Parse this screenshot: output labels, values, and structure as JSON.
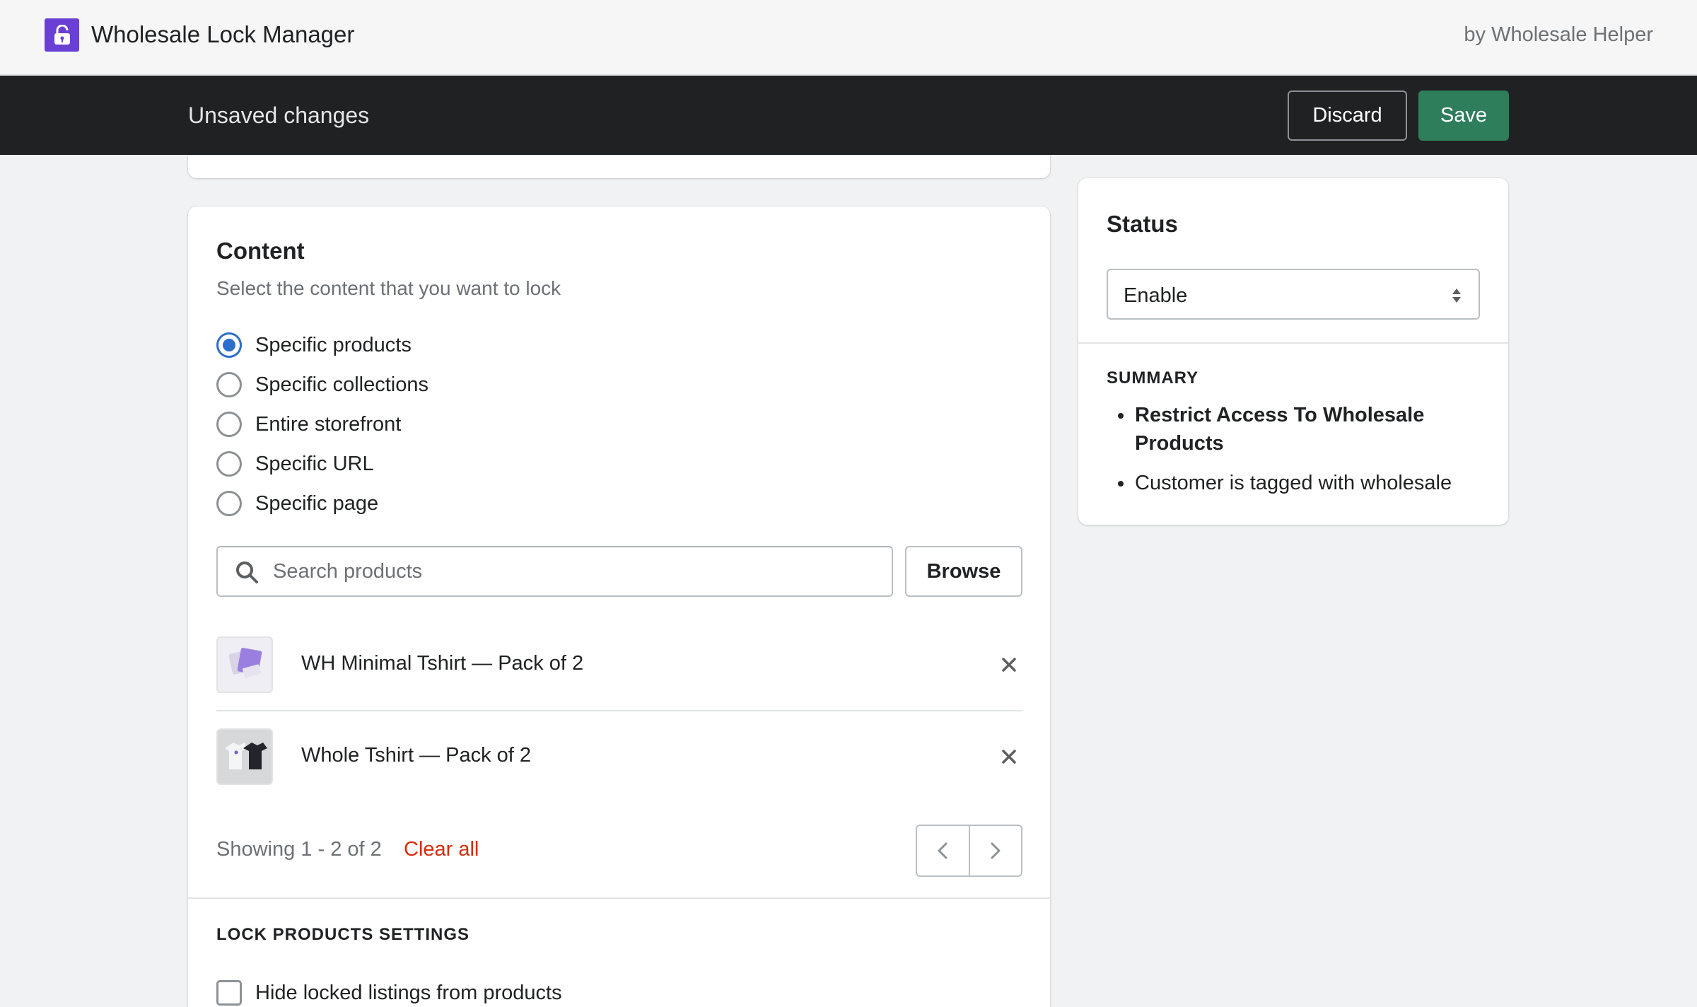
{
  "app": {
    "title": "Wholesale Lock Manager",
    "vendor": "by Wholesale Helper",
    "logo_icon": "lock-icon",
    "brand_color": "#6a3fd6"
  },
  "savebar": {
    "title": "Unsaved changes",
    "discard_label": "Discard",
    "save_label": "Save",
    "save_color": "#2e7d5b"
  },
  "content": {
    "heading": "Content",
    "subheading": "Select the content that you want to lock",
    "options": [
      {
        "label": "Specific products",
        "checked": true
      },
      {
        "label": "Specific collections",
        "checked": false
      },
      {
        "label": "Entire storefront",
        "checked": false
      },
      {
        "label": "Specific URL",
        "checked": false
      },
      {
        "label": "Specific page",
        "checked": false
      }
    ],
    "search_placeholder": "Search products",
    "browse_label": "Browse",
    "products": [
      {
        "name": "WH Minimal Tshirt — Pack of 2"
      },
      {
        "name": "Whole Tshirt — Pack of 2"
      }
    ],
    "showing_text": "Showing 1 - 2 of 2",
    "clear_all_label": "Clear all",
    "settings_heading": "LOCK PRODUCTS SETTINGS",
    "settings": [
      {
        "label": "Hide locked listings from products",
        "checked": false
      }
    ]
  },
  "status": {
    "heading": "Status",
    "selected": "Enable",
    "summary_heading": "SUMMARY",
    "summary_items": [
      {
        "text": "Restrict Access To Wholesale Products",
        "bold": true
      },
      {
        "text": "Customer is tagged with wholesale",
        "bold": false
      }
    ]
  }
}
